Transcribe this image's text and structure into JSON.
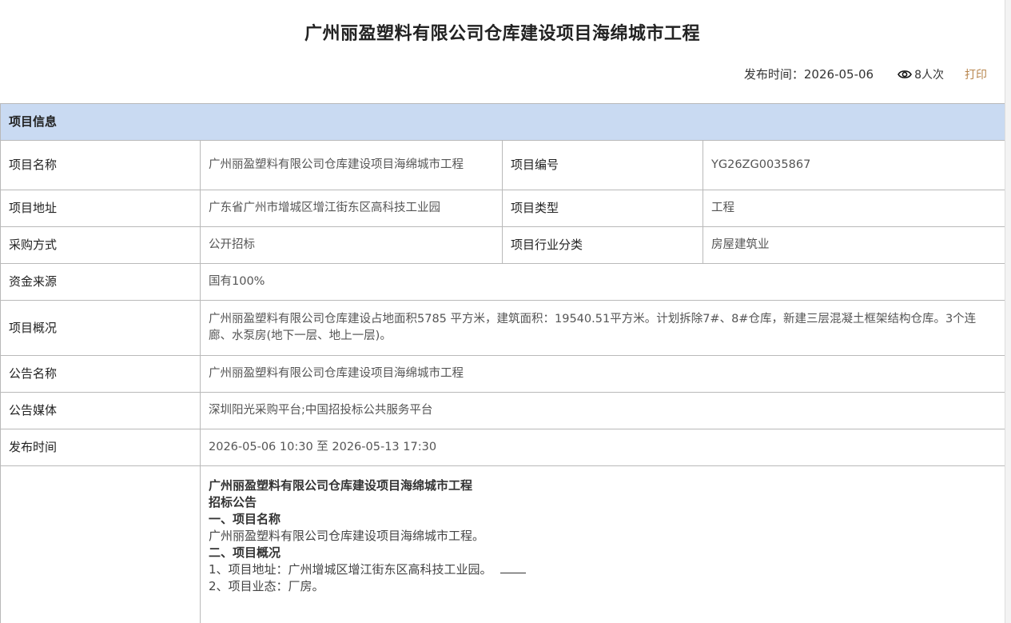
{
  "page": {
    "title": "广州丽盈塑料有限公司仓库建设项目海绵城市工程"
  },
  "meta": {
    "publish_time": "发布时间：2026-05-06",
    "views": "8人次",
    "print": "打印",
    "views_icon": "eye-icon"
  },
  "section_header": "项目信息",
  "rows": {
    "project_name_label": "项目名称",
    "project_name_value": "广州丽盈塑料有限公司仓库建设项目海绵城市工程",
    "project_no_label": "项目编号",
    "project_no_value": "YG26ZG0035867",
    "address_label": "项目地址",
    "address_value": "广东省广州市增城区增江街东区高科技工业园",
    "type_label": "项目类型",
    "type_value": "工程",
    "purchase_label": "采购方式",
    "purchase_value": "公开招标",
    "industry_label": "项目行业分类",
    "industry_value": "房屋建筑业",
    "fund_label": "资金来源",
    "fund_value": "国有100%",
    "overview_label": "项目概况",
    "overview_value": "广州丽盈塑料有限公司仓库建设占地面积5785 平方米，建筑面积：19540.51平方米。计划拆除7#、8#仓库，新建三层混凝土框架结构仓库。3个连廊、水泵房(地下一层、地上一层)。",
    "notice_name_label": "公告名称",
    "notice_name_value": "广州丽盈塑料有限公司仓库建设项目海绵城市工程",
    "media_label": "公告媒体",
    "media_value": "深圳阳光采购平台;中国招投标公共服务平台",
    "release_label": "发布时间",
    "release_value": "2026-05-06 10:30 至 2026-05-13 17:30"
  },
  "content": {
    "heading": "广州丽盈塑料有限公司仓库建设项目海绵城市工程",
    "subheading": "招标公告",
    "s1_title": "一、项目名称",
    "s1_text": "广州丽盈塑料有限公司仓库建设项目海绵城市工程。",
    "s2_title": "二、项目概况",
    "s2_item1": "1、项目地址：广州增城区增江街东区高科技工业园。",
    "s2_item2": "2、项目业态：厂房。"
  }
}
